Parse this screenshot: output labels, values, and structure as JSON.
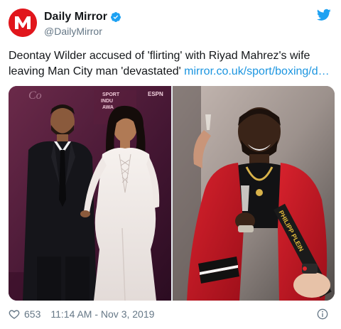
{
  "account": {
    "display_name": "Daily Mirror",
    "handle": "@DailyMirror",
    "avatar_letter": "M"
  },
  "tweet": {
    "text": "Deontay Wilder accused of 'flirting' with Riyad Mahrez's wife leaving Man City man 'devastated' ",
    "link": "mirror.co.uk/sport/boxing/d…"
  },
  "media": {
    "left_sign_1": "SPORT",
    "left_sign_2": "INDU",
    "left_sign_3": "AWA",
    "left_sign_4": "ESPN",
    "right_jacket_text": "PHILIPP PLEIN"
  },
  "footer": {
    "like_count": "653",
    "timestamp": "11:14 AM - Nov 3, 2019"
  },
  "colors": {
    "brand_red": "#e1161c",
    "twitter_blue": "#1da1f2",
    "link_blue": "#1b95e0",
    "muted_gray": "#657786"
  },
  "icons": {
    "verified": "verified-badge-icon",
    "twitter": "twitter-bird-icon",
    "like": "heart-icon",
    "info": "info-icon"
  }
}
